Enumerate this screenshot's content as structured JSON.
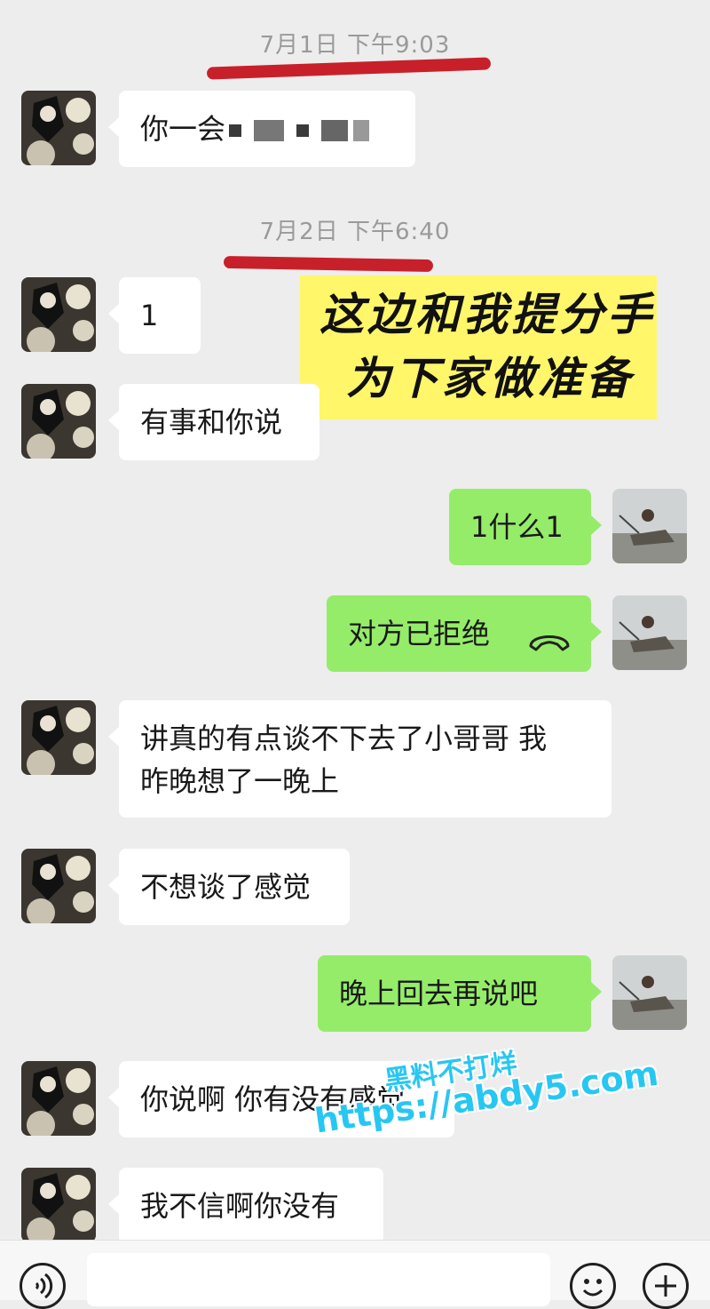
{
  "timestamps": [
    "7月1日 下午9:03",
    "7月2日 下午6:40"
  ],
  "callout": {
    "line1": "这边和我提分手",
    "line2": "为下家做准备"
  },
  "messages": [
    {
      "side": "in",
      "text": "你一会"
    },
    {
      "side": "in",
      "text": "1"
    },
    {
      "side": "in",
      "text": "有事和你说"
    },
    {
      "side": "out",
      "text": "1什么1"
    },
    {
      "side": "out",
      "text": "对方已拒绝"
    },
    {
      "side": "in",
      "line1": "讲真的有点谈不下去了小哥哥 我",
      "line2": "昨晚想了一晚上"
    },
    {
      "side": "in",
      "text": "不想谈了感觉"
    },
    {
      "side": "out",
      "text": "晚上回去再说吧"
    },
    {
      "side": "in",
      "text": "你说啊 你有没有感觉"
    },
    {
      "side": "in",
      "text": "我不信啊你没有"
    }
  ],
  "watermark": {
    "line1": "黑料不打烊",
    "line2": "https://abdy5.com"
  },
  "icons": {
    "voice": "voice-toggle-icon",
    "emoji": "emoji-icon",
    "plus": "plus-icon",
    "call_end": "call-declined-icon"
  },
  "colors": {
    "incoming": "#ffffff",
    "outgoing": "#95ec69",
    "annotation_red": "#c8202a",
    "callout_bg": "#fff66a",
    "watermark": "#27c7f2"
  }
}
